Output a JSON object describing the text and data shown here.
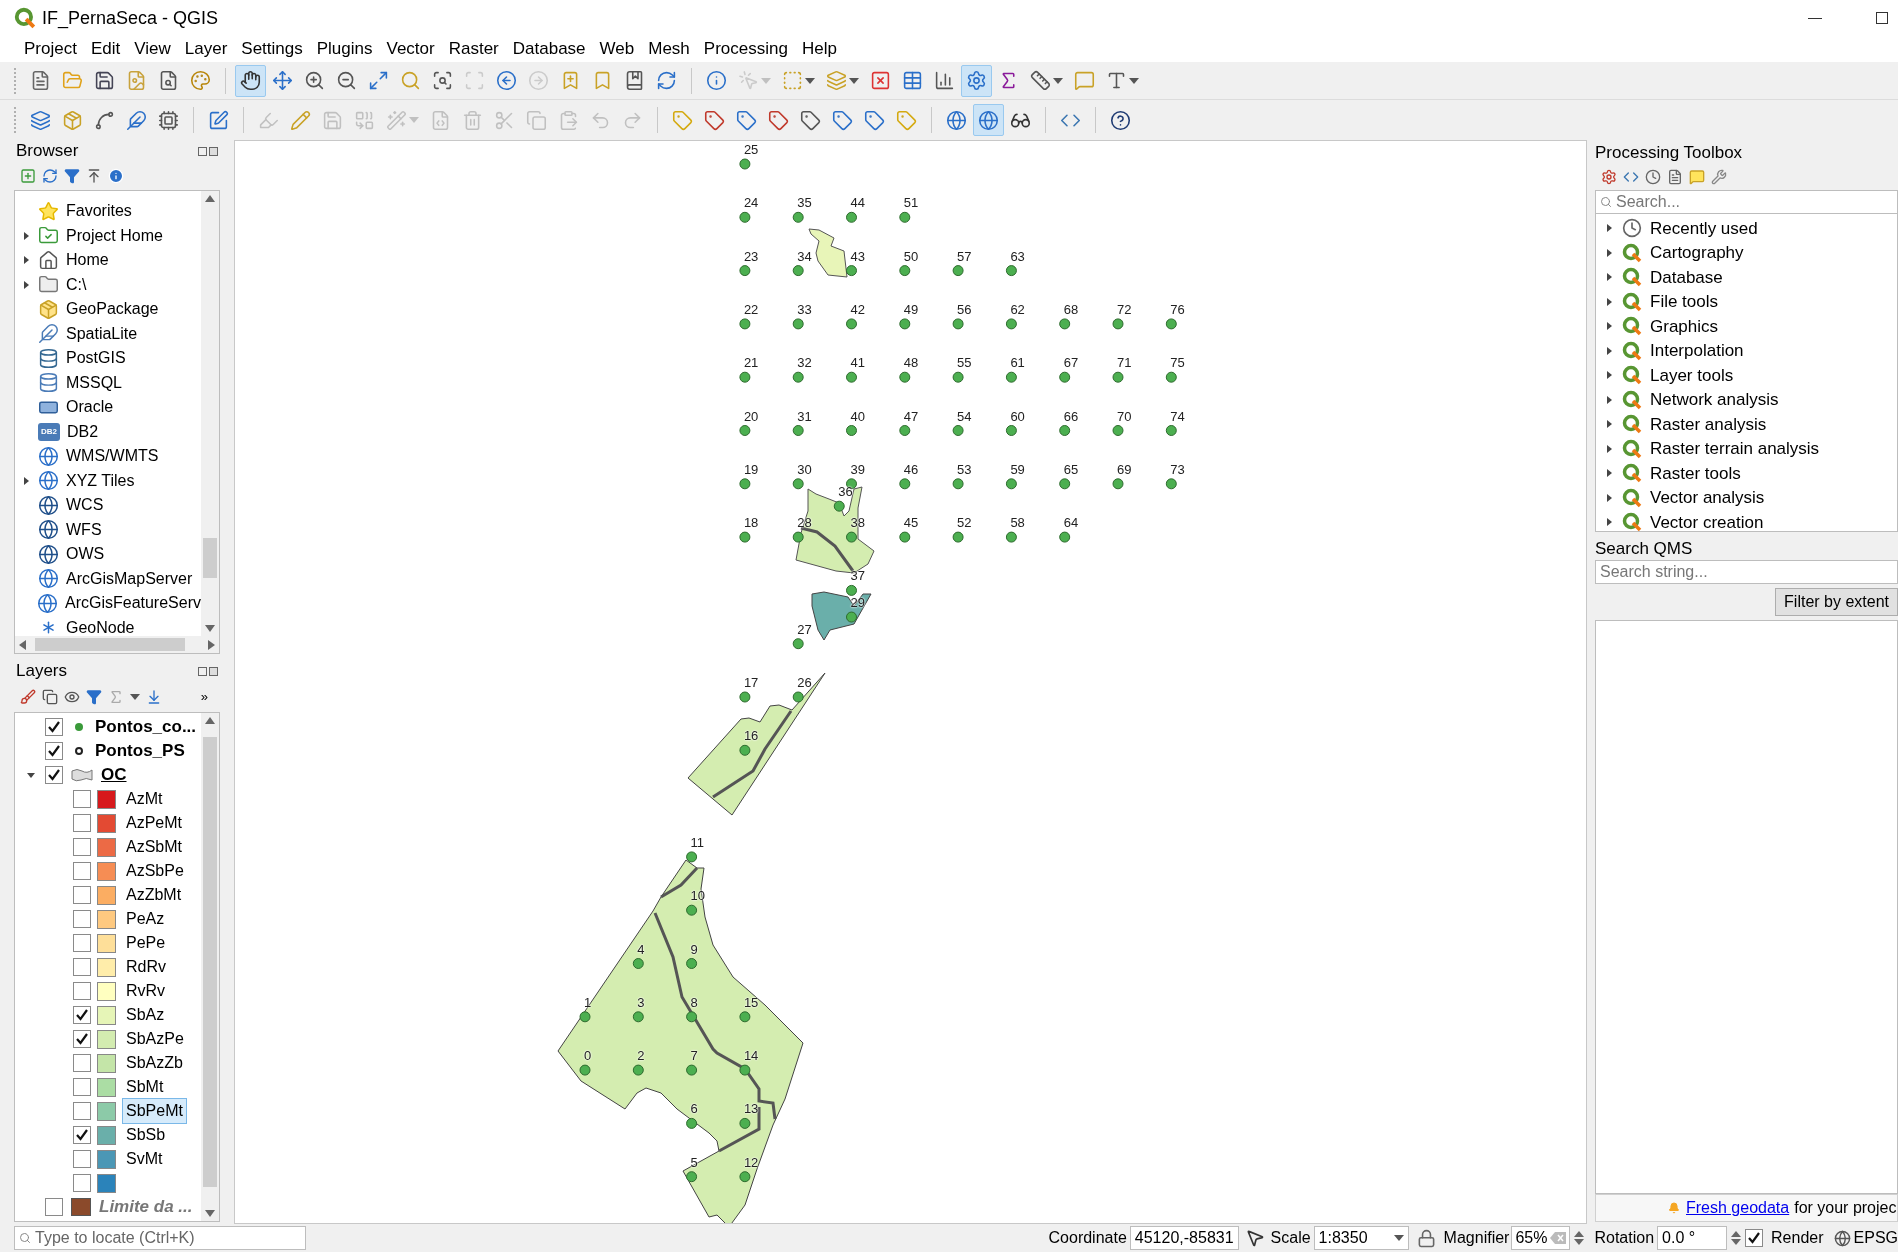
{
  "window": {
    "title": "IF_PernaSeca - QGIS"
  },
  "menu": [
    "Project",
    "Edit",
    "View",
    "Layer",
    "Settings",
    "Plugins",
    "Vector",
    "Raster",
    "Database",
    "Web",
    "Mesh",
    "Processing",
    "Help"
  ],
  "toolbars": [
    [
      {
        "disabled": false,
        "active": false
      },
      {
        "disabled": false,
        "active": false
      },
      {
        "disabled": false,
        "active": false
      },
      {
        "disabled": false,
        "active": false
      },
      {
        "disabled": false,
        "active": false
      },
      {
        "disabled": false,
        "active": false
      },
      {
        "disabled": false,
        "active": true
      },
      {
        "disabled": false,
        "active": false
      },
      {
        "disabled": false,
        "active": false
      },
      {
        "disabled": false,
        "active": false
      },
      {
        "disabled": false,
        "active": false
      },
      {
        "disabled": false,
        "active": false
      },
      {
        "disabled": false,
        "active": false
      },
      {
        "disabled": true,
        "active": false
      },
      {
        "disabled": false,
        "active": false
      },
      {
        "disabled": true,
        "active": false
      },
      {
        "disabled": false,
        "active": false
      },
      {
        "disabled": false,
        "active": false
      },
      {
        "disabled": false,
        "active": false
      },
      {
        "disabled": false,
        "active": false
      },
      {
        "disabled": false,
        "active": false
      },
      {
        "disabled": true,
        "active": false
      },
      {
        "disabled": false,
        "active": false
      },
      {
        "disabled": false,
        "active": false
      },
      {
        "disabled": false,
        "active": false
      },
      {
        "disabled": false,
        "active": false
      },
      {
        "disabled": false,
        "active": false
      },
      {
        "disabled": false,
        "active": true
      },
      {
        "disabled": false,
        "active": false
      },
      {
        "disabled": false,
        "active": false
      },
      {
        "disabled": false,
        "active": false
      },
      {
        "disabled": false,
        "active": false
      }
    ],
    [
      {
        "disabled": false,
        "active": false
      },
      {
        "disabled": false,
        "active": false
      },
      {
        "disabled": false,
        "active": false
      },
      {
        "disabled": false,
        "active": false
      },
      {
        "disabled": false,
        "active": false
      },
      {
        "disabled": false,
        "active": false
      },
      {
        "disabled": true,
        "active": false
      },
      {
        "disabled": false,
        "active": false
      },
      {
        "disabled": true,
        "active": false
      },
      {
        "disabled": true,
        "active": false
      },
      {
        "disabled": true,
        "active": false
      },
      {
        "disabled": true,
        "active": false
      },
      {
        "disabled": true,
        "active": false
      },
      {
        "disabled": true,
        "active": false
      },
      {
        "disabled": true,
        "active": false
      },
      {
        "disabled": true,
        "active": false
      },
      {
        "disabled": true,
        "active": false
      },
      {
        "disabled": true,
        "active": false
      },
      {
        "disabled": false,
        "active": false
      },
      {
        "disabled": false,
        "active": false
      },
      {
        "disabled": false,
        "active": false
      },
      {
        "disabled": false,
        "active": false
      },
      {
        "disabled": false,
        "active": false
      },
      {
        "disabled": false,
        "active": false
      },
      {
        "disabled": false,
        "active": false
      },
      {
        "disabled": false,
        "active": false
      },
      {
        "disabled": false,
        "active": false
      },
      {
        "disabled": false,
        "active": true
      },
      {
        "disabled": false,
        "active": false
      },
      {
        "disabled": false,
        "active": false
      },
      {
        "disabled": false,
        "active": false
      }
    ]
  ],
  "browser": {
    "title": "Browser",
    "items": [
      {
        "label": "Favorites",
        "has_children": false
      },
      {
        "label": "Project Home",
        "has_children": true
      },
      {
        "label": "Home",
        "has_children": true
      },
      {
        "label": "C:\\",
        "has_children": true
      },
      {
        "label": "GeoPackage",
        "has_children": false
      },
      {
        "label": "SpatiaLite",
        "has_children": false
      },
      {
        "label": "PostGIS",
        "has_children": false
      },
      {
        "label": "MSSQL",
        "has_children": false
      },
      {
        "label": "Oracle",
        "has_children": false
      },
      {
        "label": "DB2",
        "has_children": false,
        "badge": "DB2"
      },
      {
        "label": "WMS/WMTS",
        "has_children": false
      },
      {
        "label": "XYZ Tiles",
        "has_children": true
      },
      {
        "label": "WCS",
        "has_children": false
      },
      {
        "label": "WFS",
        "has_children": false
      },
      {
        "label": "OWS",
        "has_children": false
      },
      {
        "label": "ArcGisMapServer",
        "has_children": false
      },
      {
        "label": "ArcGisFeatureServ",
        "has_children": false
      },
      {
        "label": "GeoNode",
        "has_children": false
      }
    ]
  },
  "layers": {
    "title": "Layers",
    "overflow": "»",
    "items": [
      {
        "kind": "filled_point",
        "label": "Pontos_co...",
        "checked": true
      },
      {
        "kind": "hollow_point",
        "label": "Pontos_PS",
        "checked": true
      },
      {
        "kind": "polygon_group",
        "label": "OC",
        "checked": true,
        "expanded": true,
        "children": [
          {
            "label": "AzMt",
            "color": "#d7191c",
            "checked": false,
            "selected": false
          },
          {
            "label": "AzPeMt",
            "color": "#e34a33",
            "checked": false,
            "selected": false
          },
          {
            "label": "AzSbMt",
            "color": "#ec6a45",
            "checked": false,
            "selected": false
          },
          {
            "label": "AzSbPe",
            "color": "#f68d54",
            "checked": false,
            "selected": false
          },
          {
            "label": "AzZbMt",
            "color": "#fbad62",
            "checked": false,
            "selected": false
          },
          {
            "label": "PeAz",
            "color": "#fec980",
            "checked": false,
            "selected": false
          },
          {
            "label": "PePe",
            "color": "#fedf99",
            "checked": false,
            "selected": false
          },
          {
            "label": "RdRv",
            "color": "#ffedaa",
            "checked": false,
            "selected": false
          },
          {
            "label": "RvRv",
            "color": "#ffffc0",
            "checked": false,
            "selected": false
          },
          {
            "label": "SbAz",
            "color": "#e6f5b7",
            "checked": true,
            "selected": false
          },
          {
            "label": "SbAzPe",
            "color": "#d3ecb0",
            "checked": true,
            "selected": false
          },
          {
            "label": "SbAzZb",
            "color": "#c4e5a8",
            "checked": false,
            "selected": false
          },
          {
            "label": "SbMt",
            "color": "#abdda4",
            "checked": false,
            "selected": false
          },
          {
            "label": "SbPeMt",
            "color": "#8ccaa8",
            "checked": false,
            "selected": true
          },
          {
            "label": "SbSb",
            "color": "#6aafaa",
            "checked": true,
            "selected": false
          },
          {
            "label": "SvMt",
            "color": "#4b97b5",
            "checked": false,
            "selected": false
          },
          {
            "color": "#2b83ba",
            "checked": false,
            "selected": false
          }
        ]
      },
      {
        "kind": "swatch_layer",
        "label": "Limite da ...",
        "color": "#8b4a2b",
        "checked": false
      }
    ]
  },
  "map": {
    "points": [
      {
        "label": "25"
      },
      {
        "label": "24"
      },
      {
        "label": "35"
      },
      {
        "label": "44"
      },
      {
        "label": "51"
      },
      {
        "label": "23"
      },
      {
        "label": "34"
      },
      {
        "label": "43"
      },
      {
        "label": "50"
      },
      {
        "label": "57"
      },
      {
        "label": "63"
      },
      {
        "label": "22"
      },
      {
        "label": "33"
      },
      {
        "label": "42"
      },
      {
        "label": "49"
      },
      {
        "label": "56"
      },
      {
        "label": "62"
      },
      {
        "label": "68"
      },
      {
        "label": "72"
      },
      {
        "label": "76"
      },
      {
        "label": "21"
      },
      {
        "label": "32"
      },
      {
        "label": "41"
      },
      {
        "label": "48"
      },
      {
        "label": "55"
      },
      {
        "label": "61"
      },
      {
        "label": "67"
      },
      {
        "label": "71"
      },
      {
        "label": "75"
      },
      {
        "label": "20"
      },
      {
        "label": "31"
      },
      {
        "label": "40"
      },
      {
        "label": "47"
      },
      {
        "label": "54"
      },
      {
        "label": "60"
      },
      {
        "label": "66"
      },
      {
        "label": "70"
      },
      {
        "label": "74"
      },
      {
        "label": "19"
      },
      {
        "label": "30"
      },
      {
        "label": "39"
      },
      {
        "label": "46"
      },
      {
        "label": "53"
      },
      {
        "label": "59"
      },
      {
        "label": "65"
      },
      {
        "label": "69"
      },
      {
        "label": "73"
      },
      {
        "label": "18"
      },
      {
        "label": "28"
      },
      {
        "label": "38"
      },
      {
        "label": "45"
      },
      {
        "label": "52"
      },
      {
        "label": "58"
      },
      {
        "label": "64"
      },
      {
        "label": "36"
      },
      {
        "label": "37"
      },
      {
        "label": "27"
      },
      {
        "label": "29"
      },
      {
        "label": "17"
      },
      {
        "label": "26"
      },
      {
        "label": "16"
      },
      {
        "label": "11"
      },
      {
        "label": "10"
      },
      {
        "label": "4"
      },
      {
        "label": "9"
      },
      {
        "label": "1"
      },
      {
        "label": "3"
      },
      {
        "label": "8"
      },
      {
        "label": "15"
      },
      {
        "label": "0"
      },
      {
        "label": "2"
      },
      {
        "label": "7"
      },
      {
        "label": "14"
      },
      {
        "label": "6"
      },
      {
        "label": "13"
      },
      {
        "label": "5"
      },
      {
        "label": "12"
      }
    ]
  },
  "processing": {
    "title": "Processing Toolbox",
    "placeholder": "Search...",
    "items": [
      {
        "kind": "history",
        "label": "Recently used",
        "expanded": false
      },
      {
        "kind": "provider",
        "label": "Cartography",
        "expanded": false
      },
      {
        "kind": "provider",
        "label": "Database",
        "expanded": false
      },
      {
        "kind": "provider",
        "label": "File tools",
        "expanded": false
      },
      {
        "kind": "provider",
        "label": "Graphics",
        "expanded": false
      },
      {
        "kind": "provider",
        "label": "Interpolation",
        "expanded": false
      },
      {
        "kind": "provider",
        "label": "Layer tools",
        "expanded": false
      },
      {
        "kind": "provider",
        "label": "Network analysis",
        "expanded": false
      },
      {
        "kind": "provider",
        "label": "Raster analysis",
        "expanded": false
      },
      {
        "kind": "provider",
        "label": "Raster terrain analysis",
        "expanded": false
      },
      {
        "kind": "provider",
        "label": "Raster tools",
        "expanded": false
      },
      {
        "kind": "provider",
        "label": "Vector analysis",
        "expanded": false
      },
      {
        "kind": "provider",
        "label": "Vector creation",
        "expanded": false
      }
    ]
  },
  "qms": {
    "title": "Search QMS",
    "placeholder": "Search string...",
    "button": "Filter by extent",
    "notice_link": "Fresh geodata",
    "notice_text": "for your projec"
  },
  "status_bar": {
    "locate_placeholder": "Type to locate (Ctrl+K)",
    "coordinate_label": "Coordinate",
    "coordinate": "45120,-85831",
    "scale_label": "Scale",
    "scale": "1:8350",
    "magnifier_label": "Magnifier",
    "magnifier": "65%",
    "rotation_label": "Rotation",
    "rotation": "0.0 °",
    "render_label": "Render",
    "render": true,
    "crs": "EPSG"
  }
}
